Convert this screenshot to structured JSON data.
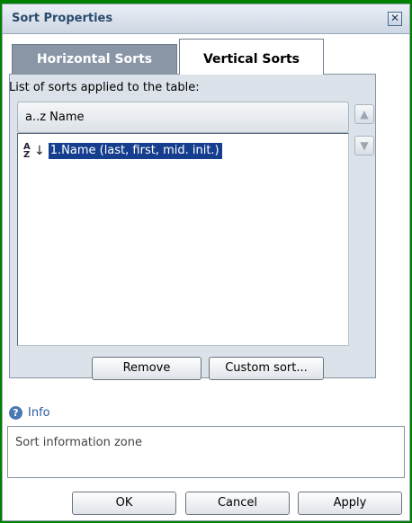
{
  "window": {
    "title": "Sort Properties",
    "close_icon": "close-icon"
  },
  "tabs": [
    {
      "label": "Horizontal Sorts",
      "active": false
    },
    {
      "label": "Vertical Sorts",
      "active": true
    }
  ],
  "sorts_panel": {
    "caption": "List of sorts applied to the table:",
    "header": "a..z Name",
    "items": [
      {
        "icon": "sort-ascending-icon",
        "icon_glyph": "A\nZ",
        "label": "1.Name (last, first, mid. init.)",
        "selected": true
      }
    ],
    "move_up_icon": "arrow-up-icon",
    "move_down_icon": "arrow-down-icon",
    "remove_label": "Remove",
    "custom_sort_label": "Custom sort..."
  },
  "info": {
    "icon": "question-icon",
    "label": "Info",
    "zone_text": "Sort information zone"
  },
  "footer": {
    "ok_label": "OK",
    "cancel_label": "Cancel",
    "apply_label": "Apply"
  },
  "colors": {
    "background": "#008000",
    "selection": "#153e8e",
    "inactive_tab": "#8a96a6",
    "panel": "#dce2e9",
    "info_link": "#2b5aa0"
  }
}
